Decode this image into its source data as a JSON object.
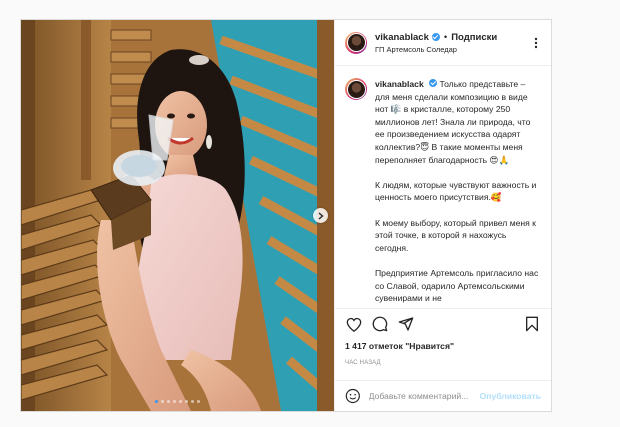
{
  "post": {
    "username": "vikanablack",
    "follow_label": "Подписки",
    "separator": "•",
    "location": "ГП Артемсоль Соледар",
    "caption": [
      "Только представьте – для меня сделали композицию в виде нот 🎼 в кристалле, которому 250 миллионов лет! Знала ли природа, что ее произведением искусства одарят коллектив?😇 В такие моменты меня переполняет благодарность 😍🙏",
      "К людям, которые чувствуют важность и ценность моего присутствия.🥰",
      "К моему выбору, который привел меня к этой точке, в которой я нахожусь сегодня.",
      "Предприятие Артемсоль пригласило нас со Славой, одарило Артемсольскими сувенирами и не"
    ],
    "likes": "1 417 отметок \"Нравится\"",
    "time": "ЧАС НАЗАД",
    "comment_placeholder": "Добавьте комментарий...",
    "publish_label": "Опубликовать"
  },
  "carousel": {
    "slide_count": 8,
    "active_index": 0
  },
  "colors": {
    "accent": "#3897f0",
    "publish_disabled": "#b2dffc",
    "border": "#dbdbdb",
    "text": "#262626",
    "muted": "#8e8e8e"
  },
  "icons": {
    "like": "heart-icon",
    "comment": "comment-icon",
    "share": "share-icon",
    "save": "bookmark-icon",
    "emoji": "emoji-icon",
    "more": "more-icon",
    "next": "chevron-right-icon",
    "verified": "verified-badge-icon"
  }
}
